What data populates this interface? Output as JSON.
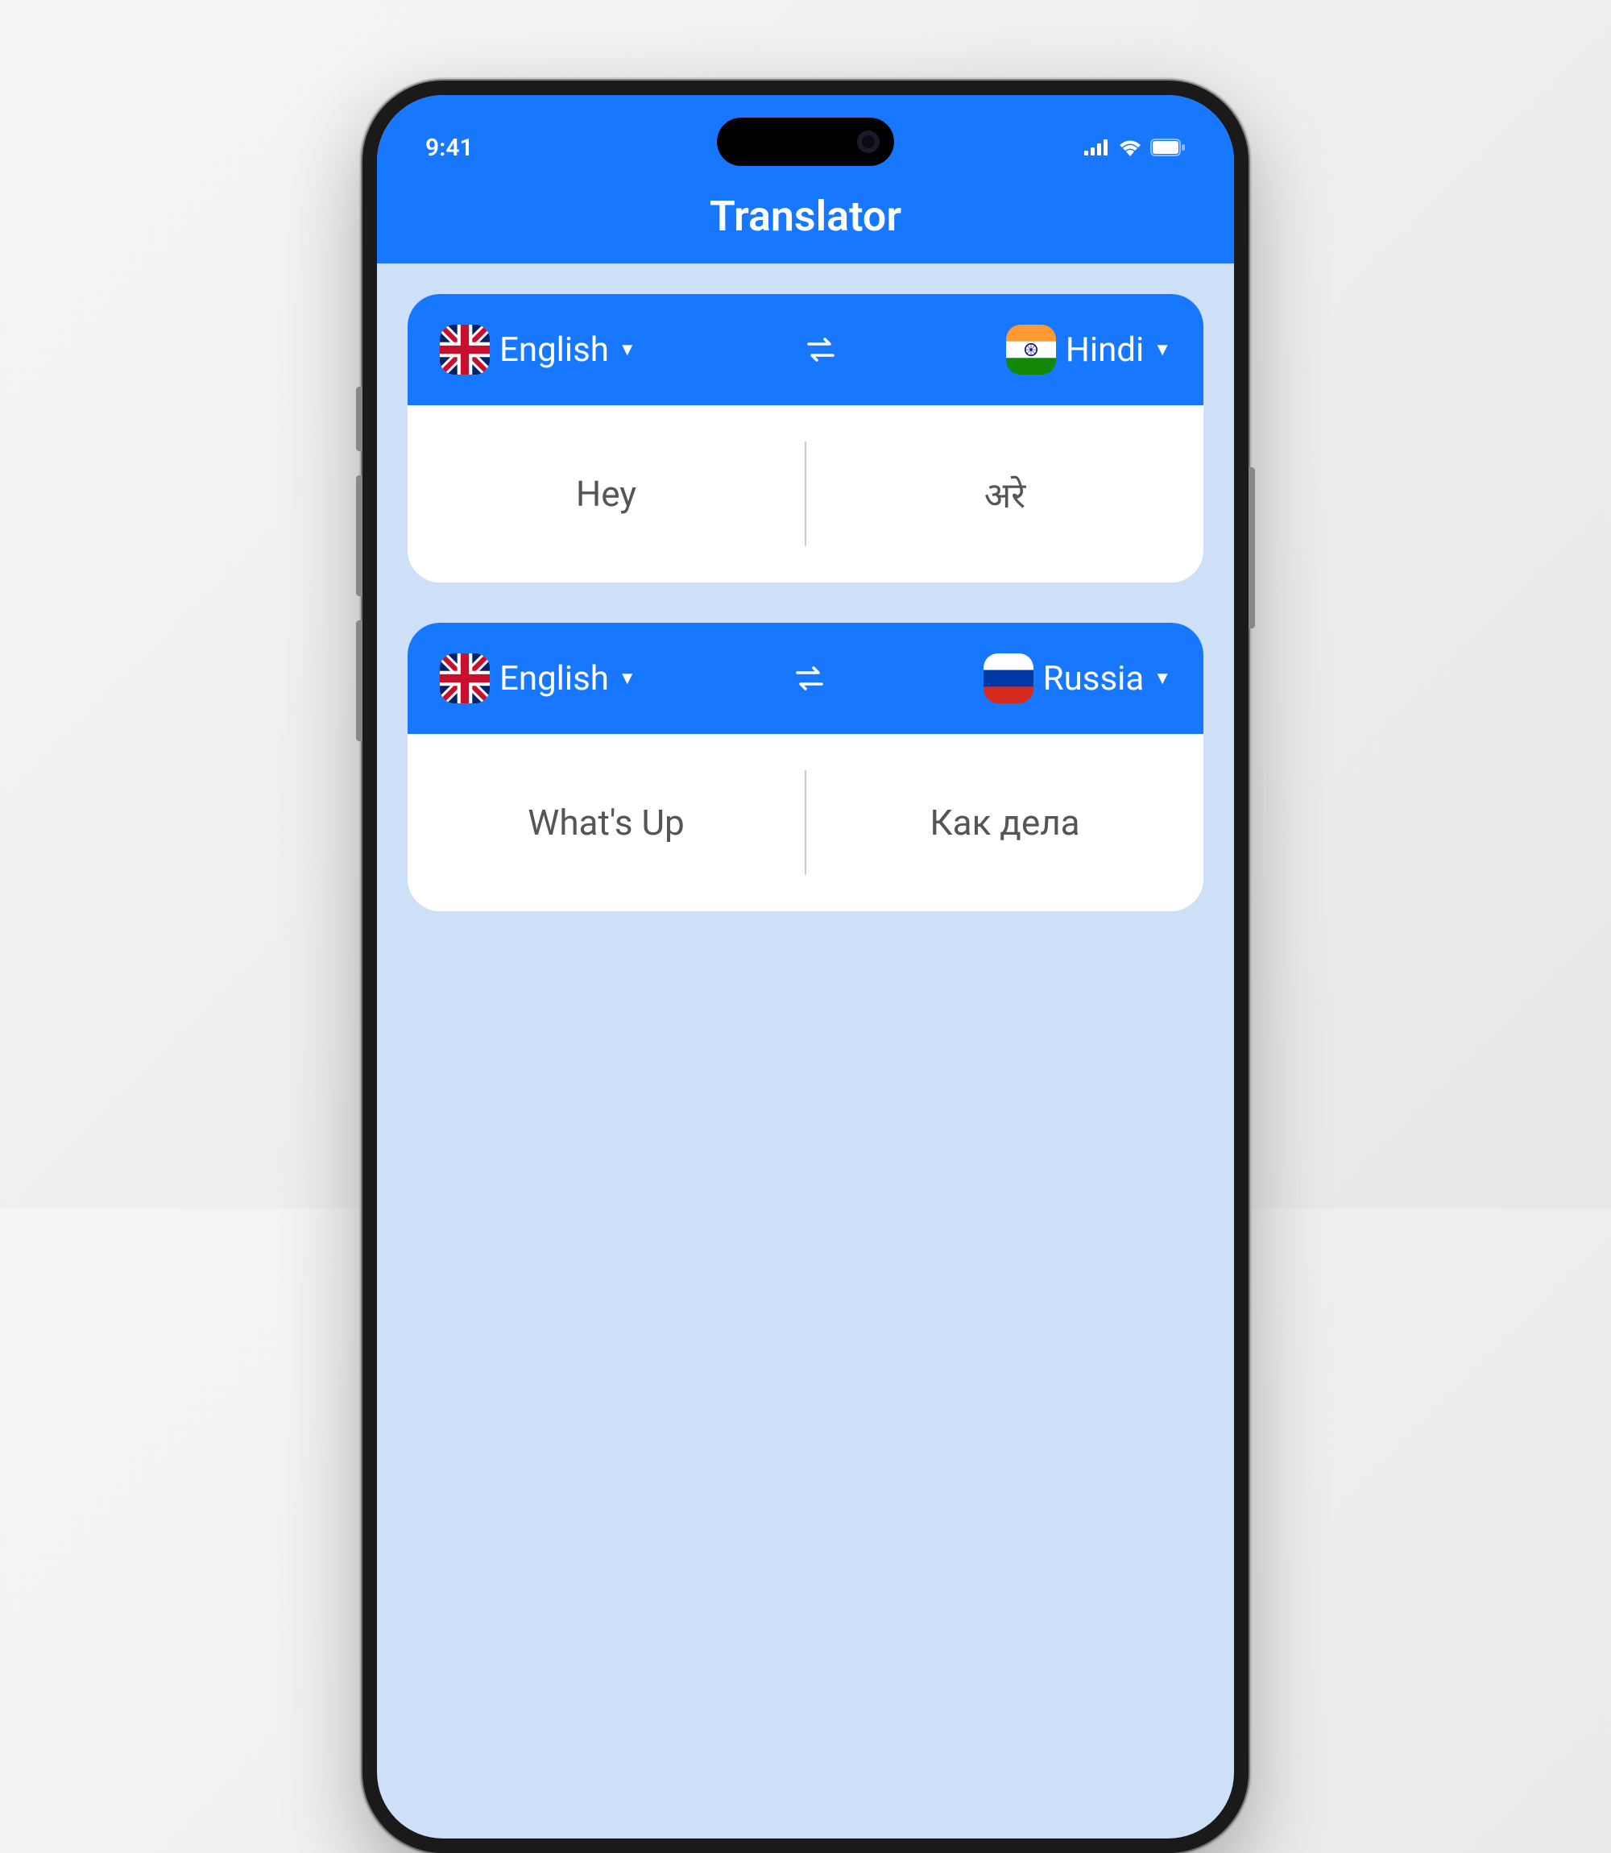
{
  "status_bar": {
    "time": "9:41"
  },
  "header": {
    "title": "Translator"
  },
  "cards": [
    {
      "source_lang": "English",
      "source_flag": "uk",
      "target_lang": "Hindi",
      "target_flag": "india",
      "source_text": "Hey",
      "target_text": "अरे"
    },
    {
      "source_lang": "English",
      "source_flag": "uk",
      "target_lang": "Russia",
      "target_flag": "russia",
      "source_text": "What's Up",
      "target_text": "Как дела"
    }
  ],
  "colors": {
    "primary": "#1778FF",
    "background": "#CDE0F7"
  }
}
